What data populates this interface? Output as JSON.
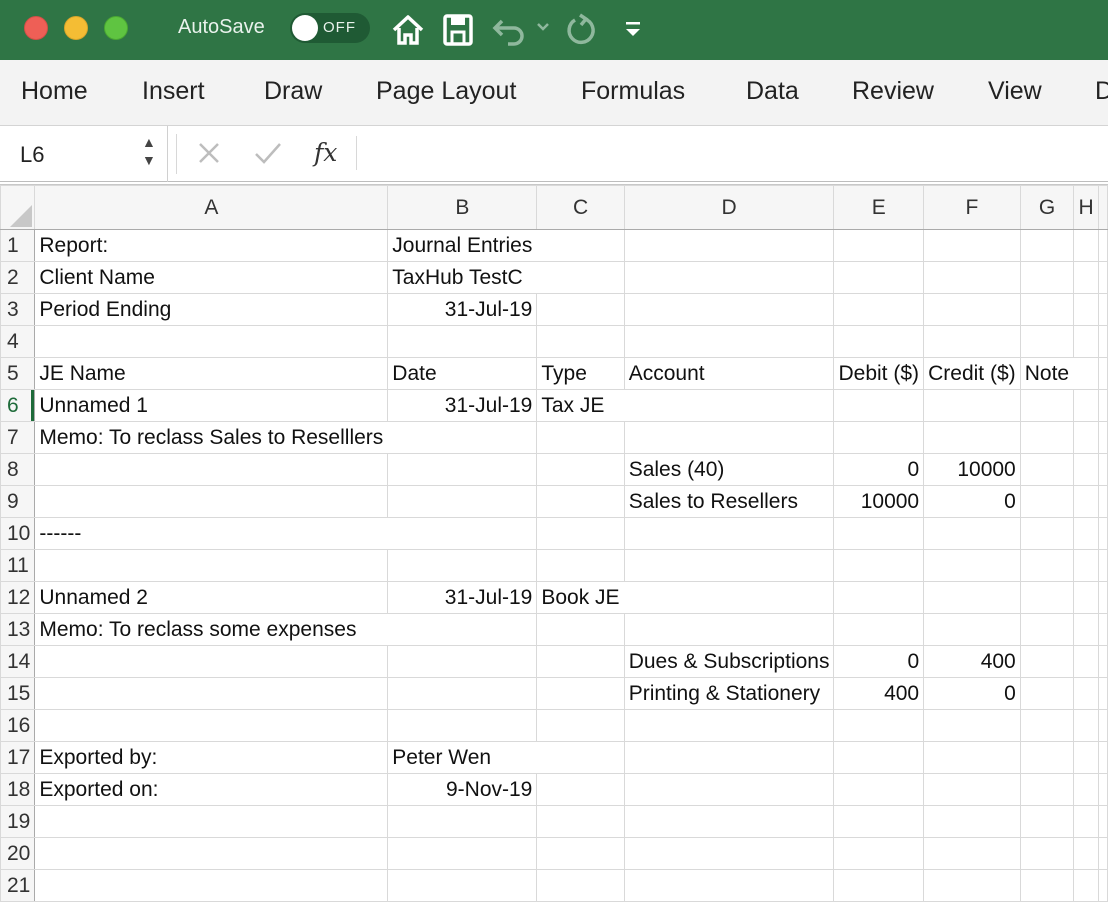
{
  "titlebar": {
    "autosave_label": "AutoSave",
    "toggle_state": "OFF"
  },
  "ribbon": {
    "tabs": [
      "Home",
      "Insert",
      "Draw",
      "Page Layout",
      "Formulas",
      "Data",
      "Review",
      "View",
      "D"
    ]
  },
  "formula_bar": {
    "cell_ref": "L6",
    "fx_label": "fx",
    "value": ""
  },
  "sheet": {
    "columns": [
      "A",
      "B",
      "C",
      "D",
      "E",
      "F",
      "G",
      "H"
    ],
    "active_row": "6",
    "rows": [
      {
        "n": "1",
        "A": "Report:",
        "B": "Journal Entries"
      },
      {
        "n": "2",
        "A": "Client Name",
        "B": "TaxHub TestC"
      },
      {
        "n": "3",
        "A": "Period Ending",
        "B": "31-Jul-19"
      },
      {
        "n": "4"
      },
      {
        "n": "5",
        "A": "JE Name",
        "B": "Date",
        "C": "Type",
        "D": "Account",
        "E": "Debit ($)",
        "F": "Credit ($)",
        "G": "Note"
      },
      {
        "n": "6",
        "A": "Unnamed 1",
        "B": "31-Jul-19",
        "C": "Tax JE"
      },
      {
        "n": "7",
        "A": "Memo: To reclass Sales to Reselllers"
      },
      {
        "n": "8",
        "D": "Sales (40)",
        "E": "0",
        "F": "10000"
      },
      {
        "n": "9",
        "D": "Sales to Resellers",
        "E": "10000",
        "F": "0"
      },
      {
        "n": "10",
        "A": "------"
      },
      {
        "n": "11"
      },
      {
        "n": "12",
        "A": "Unnamed 2",
        "B": "31-Jul-19",
        "C": "Book JE"
      },
      {
        "n": "13",
        "A": "Memo: To reclass some expenses"
      },
      {
        "n": "14",
        "D": "Dues & Subscriptions",
        "E": "0",
        "F": "400"
      },
      {
        "n": "15",
        "D": "Printing & Stationery",
        "E": "400",
        "F": "0"
      },
      {
        "n": "16"
      },
      {
        "n": "17",
        "A": "Exported by:",
        "B": "Peter Wen"
      },
      {
        "n": "18",
        "A": "Exported on:",
        "B": "9-Nov-19"
      },
      {
        "n": "19"
      },
      {
        "n": "20"
      },
      {
        "n": "21"
      }
    ]
  },
  "colors": {
    "titlebar_bg": "#2f7545",
    "accent": "#1e6b3a"
  }
}
